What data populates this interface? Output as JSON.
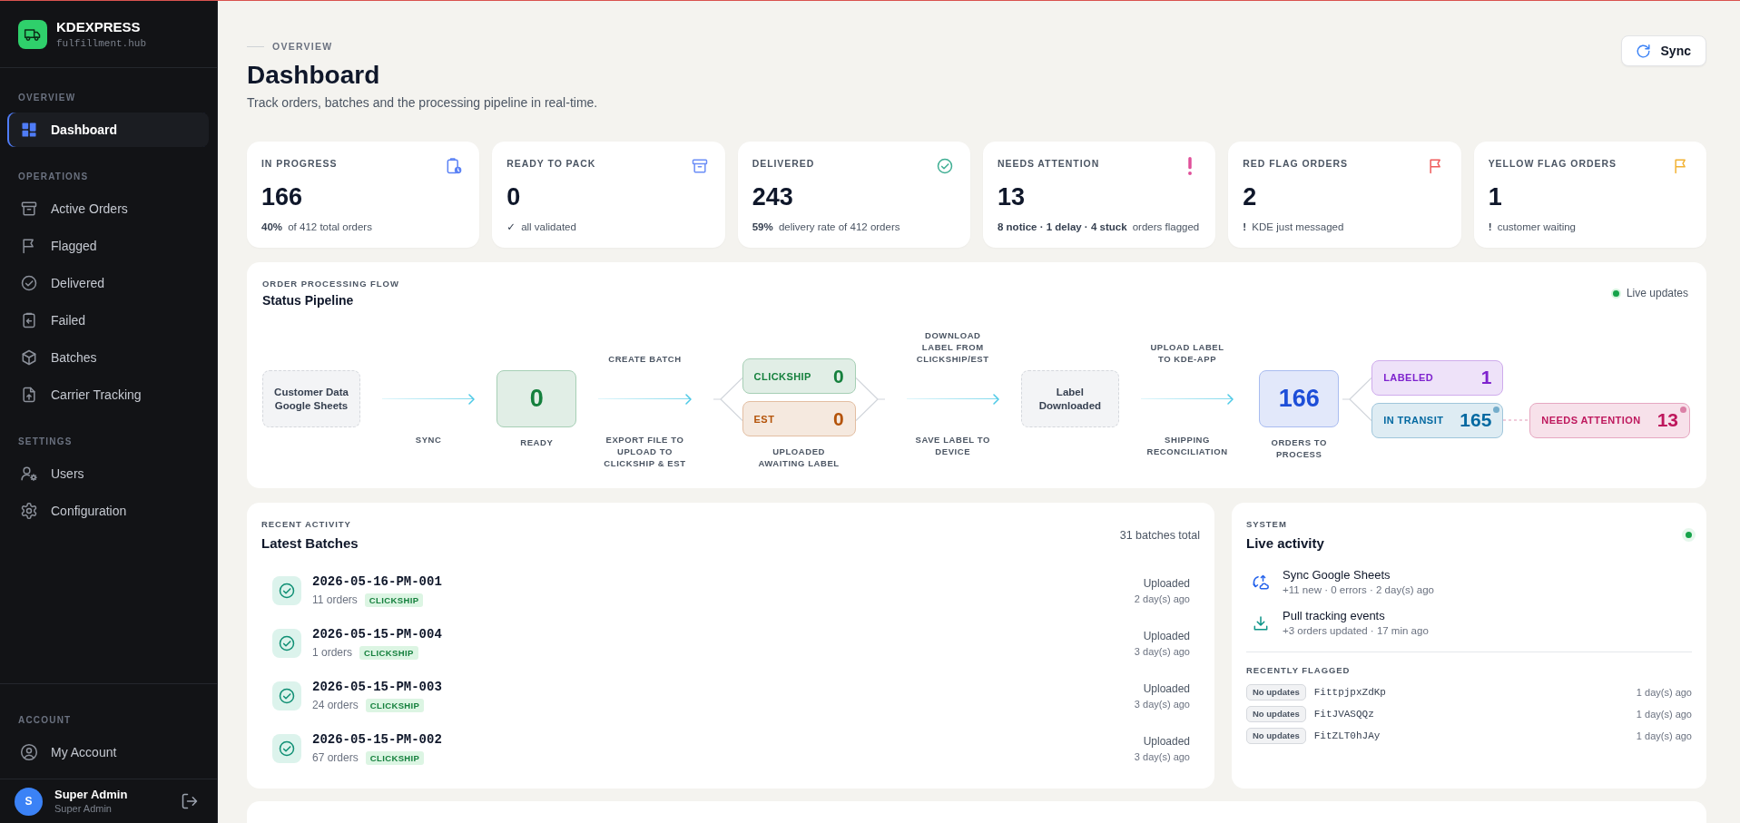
{
  "sidebar": {
    "brand": {
      "name": "KDEXPRESS",
      "tagline": "fulfillment.hub"
    },
    "sections": [
      {
        "title": "OVERVIEW",
        "items": [
          {
            "label": "Dashboard",
            "selected": true
          }
        ]
      },
      {
        "title": "OPERATIONS",
        "items": [
          {
            "label": "Active Orders",
            "selected": false
          },
          {
            "label": "Flagged",
            "selected": false
          },
          {
            "label": "Delivered",
            "selected": false
          },
          {
            "label": "Failed",
            "selected": false
          },
          {
            "label": "Batches",
            "selected": false
          },
          {
            "label": "Carrier Tracking",
            "selected": false
          }
        ]
      },
      {
        "title": "SETTINGS",
        "items": [
          {
            "label": "Users",
            "selected": false
          },
          {
            "label": "Configuration",
            "selected": false
          }
        ]
      }
    ],
    "account_section": {
      "title": "ACCOUNT",
      "items": [
        {
          "label": "My Account",
          "selected": false
        }
      ]
    },
    "user": {
      "initial": "S",
      "name": "Super Admin",
      "role": "Super Admin"
    }
  },
  "header": {
    "eyebrow": "OVERVIEW",
    "title": "Dashboard",
    "subtitle": "Track orders, batches and the processing pipeline in real-time.",
    "sync_button": "Sync"
  },
  "stats": [
    {
      "label": "IN PROGRESS",
      "value": "166",
      "note": "**40%** of 412 total orders",
      "color": "#5b82f5"
    },
    {
      "label": "READY TO PACK",
      "value": "0",
      "note": "**✓** all validated",
      "color": "#6b8ef7"
    },
    {
      "label": "DELIVERED",
      "value": "243",
      "note": "**59%** delivery rate of 412 orders",
      "color": "#3fae93"
    },
    {
      "label": "NEEDS ATTENTION",
      "value": "13",
      "note": "**8 notice · 1 delay · 4 stuck** orders flagged",
      "color": "#e0509a"
    },
    {
      "label": "RED FLAG ORDERS",
      "value": "2",
      "note": "**!** KDE just messaged",
      "color": "#ef5b5b"
    },
    {
      "label": "YELLOW FLAG ORDERS",
      "value": "1",
      "note": "**!** customer waiting",
      "color": "#f2b233"
    }
  ],
  "pipeline": {
    "eyebrow": "ORDER PROCESSING FLOW",
    "title": "Status Pipeline",
    "live": true,
    "live_label": "Live updates",
    "flow": [
      {
        "kind": "step",
        "text": "Customer Data Google Sheets"
      },
      {
        "kind": "arrow",
        "below": "SYNC"
      },
      {
        "kind": "stage",
        "value": "0",
        "caption": "READY",
        "color": "#15803d"
      },
      {
        "kind": "arrow",
        "above": "CREATE BATCH",
        "below": "EXPORT FILE TO UPLOAD TO CLICKSHIP & EST"
      },
      {
        "kind": "split",
        "caption": "UPLOADED AWAITING LABEL",
        "branches": [
          {
            "label": "CLICKSHIP",
            "value": "0",
            "color": "#15803d",
            "live": false
          },
          {
            "label": "EST",
            "value": "0",
            "color": "#b45309",
            "live": false
          }
        ]
      },
      {
        "kind": "arrow",
        "above": "DOWNLOAD LABEL FROM CLICKSHIP/EST",
        "below": "SAVE LABEL TO DEVICE"
      },
      {
        "kind": "step",
        "text": "Label Downloaded"
      },
      {
        "kind": "arrow",
        "above": "UPLOAD LABEL TO KDE-APP",
        "below": "SHIPPING RECONCILIATION"
      },
      {
        "kind": "stage",
        "value": "166",
        "caption": "ORDERS TO PROCESS",
        "color": "#1d4ed8"
      },
      {
        "kind": "split",
        "branches": [
          {
            "label": "LABELED",
            "value": "1",
            "color": "#7e22ce",
            "live": false
          },
          {
            "label": "IN TRANSIT",
            "value": "165",
            "color": "#0369a1",
            "live": true,
            "escalation": {
              "label": "NEEDS ATTENTION",
              "value": "13",
              "color": "#be185d",
              "live": true
            }
          }
        ]
      }
    ]
  },
  "batches": {
    "eyebrow": "RECENT ACTIVITY",
    "title": "Latest Batches",
    "total": "31 batches total",
    "rows": [
      {
        "id": "2026-05-16-PM-001",
        "orders": "11 orders",
        "carrier": "CLICKSHIP",
        "status": "Uploaded",
        "time": "2 day(s) ago"
      },
      {
        "id": "2026-05-15-PM-004",
        "orders": "1 orders",
        "carrier": "CLICKSHIP",
        "status": "Uploaded",
        "time": "3 day(s) ago"
      },
      {
        "id": "2026-05-15-PM-003",
        "orders": "24 orders",
        "carrier": "CLICKSHIP",
        "status": "Uploaded",
        "time": "3 day(s) ago"
      },
      {
        "id": "2026-05-15-PM-002",
        "orders": "67 orders",
        "carrier": "CLICKSHIP",
        "status": "Uploaded",
        "time": "3 day(s) ago"
      }
    ]
  },
  "system": {
    "eyebrow": "SYSTEM",
    "title": "Live activity",
    "live": true,
    "activities": [
      {
        "title": "Sync Google Sheets",
        "detail": "+11 new · 0 errors · 2 day(s) ago"
      },
      {
        "title": "Pull tracking events",
        "detail": "+3 orders updated · 17 min ago"
      }
    ],
    "flagged_title": "RECENTLY FLAGGED",
    "flagged": [
      {
        "status": "No updates",
        "order": "FittpjpxZdKp",
        "time": "1 day(s) ago"
      },
      {
        "status": "No updates",
        "order": "FitJVASQQz",
        "time": "1 day(s) ago"
      },
      {
        "status": "No updates",
        "order": "FitZLT0hJAy",
        "time": "1 day(s) ago"
      }
    ]
  }
}
